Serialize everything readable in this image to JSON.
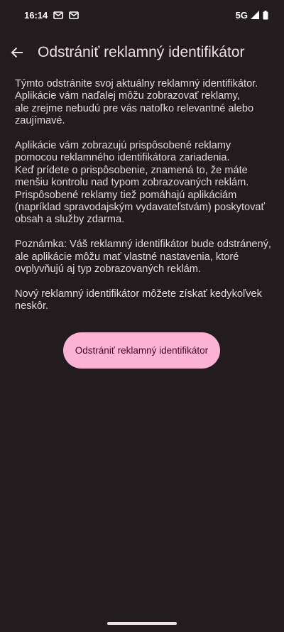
{
  "status_bar": {
    "time": "16:14",
    "network": "5G",
    "notification_icons": [
      "gmail-icon",
      "gmail-icon"
    ],
    "system_icons": [
      "signal-icon",
      "battery-icon"
    ]
  },
  "app_bar": {
    "back_icon": "arrow-back-icon",
    "title": "Odstrániť reklamný identifikátor"
  },
  "content": {
    "paragraphs": [
      "Týmto odstránite svoj aktuálny reklamný identifikátor.\nAplikácie vám naďalej môžu zobrazovať reklamy,\nale zrejme nebudú pre vás natoľko relevantné alebo\nzaujímavé.",
      "Aplikácie vám zobrazujú prispôsobené reklamy\npomocou reklamného identifikátora zariadenia.\nKeď prídete o prispôsobenie, znamená to, že máte\nmenšiu kontrolu nad typom zobrazovaných reklám.\nPrispôsobené reklamy tiež pomáhajú aplikáciám\n(napríklad spravodajským vydavateľstvám) poskytovať\nobsah a služby zdarma.",
      "Poznámka: Váš reklamný identifikátor bude odstránený,\nale aplikácie môžu mať vlastné nastavenia, ktoré\novplyvňujú aj typ zobrazovaných reklám.",
      "Nový reklamný identifikátor môžete získať kedykoľvek\nneskôr."
    ]
  },
  "action": {
    "button_label": "Odstrániť reklamný identifikátor"
  },
  "colors": {
    "background": "#221c1f",
    "button": "#fbb2d3",
    "button_text": "#3f0e2a",
    "text": "#e2d8dc"
  }
}
